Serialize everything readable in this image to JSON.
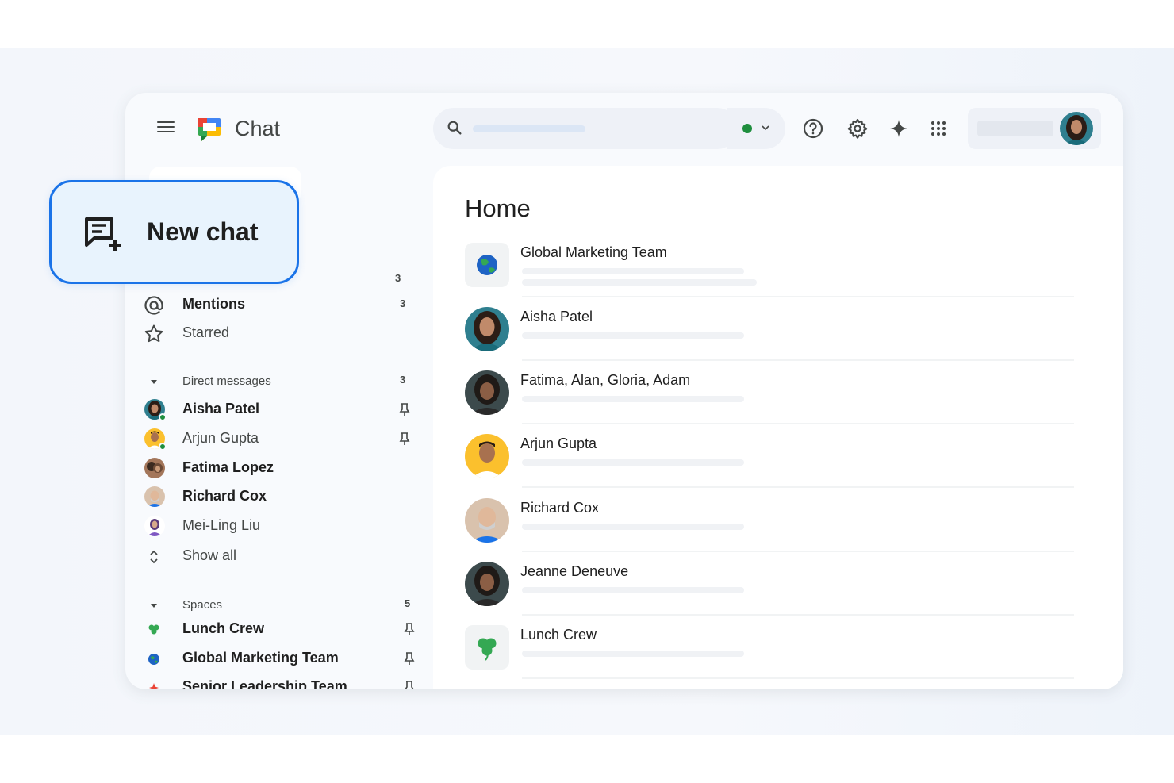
{
  "app": {
    "title": "Chat"
  },
  "new_chat": {
    "label": "New chat"
  },
  "sidebar": {
    "top_count": "3",
    "shortcuts": [
      {
        "label": "Mentions",
        "icon": "at-icon",
        "count": "3"
      },
      {
        "label": "Starred",
        "icon": "star-icon",
        "count": ""
      }
    ],
    "direct_messages": {
      "header": "Direct messages",
      "count": "3",
      "items": [
        {
          "label": "Aisha Patel",
          "unread": true,
          "pinned": true,
          "online": true
        },
        {
          "label": "Arjun Gupta",
          "unread": false,
          "pinned": true,
          "online": true
        },
        {
          "label": "Fatima Lopez",
          "unread": true,
          "pinned": false,
          "online": false
        },
        {
          "label": "Richard Cox",
          "unread": true,
          "pinned": false,
          "online": false
        },
        {
          "label": "Mei-Ling Liu",
          "unread": false,
          "pinned": false,
          "online": false
        }
      ],
      "show_all": "Show all"
    },
    "spaces": {
      "header": "Spaces",
      "count": "5",
      "items": [
        {
          "label": "Lunch Crew",
          "icon": "clover-icon",
          "pinned": true
        },
        {
          "label": "Global Marketing Team",
          "icon": "globe-icon",
          "pinned": true
        },
        {
          "label": "Senior Leadership Team",
          "icon": "sparkle-icon",
          "pinned": true
        }
      ]
    }
  },
  "main": {
    "title": "Home",
    "conversations": [
      {
        "name": "Global Marketing Team",
        "avatar": "globe-icon"
      },
      {
        "name": "Aisha Patel",
        "avatar": "avatar"
      },
      {
        "name": "Fatima, Alan, Gloria, Adam",
        "avatar": "avatar"
      },
      {
        "name": "Arjun Gupta",
        "avatar": "avatar"
      },
      {
        "name": "Richard Cox",
        "avatar": "avatar"
      },
      {
        "name": "Jeanne Deneuve",
        "avatar": "avatar"
      },
      {
        "name": "Lunch Crew",
        "avatar": "clover-icon"
      }
    ]
  },
  "colors": {
    "accent": "#1a73e8",
    "online": "#1e8e3e",
    "new_chat_bg": "#e8f3fd"
  }
}
